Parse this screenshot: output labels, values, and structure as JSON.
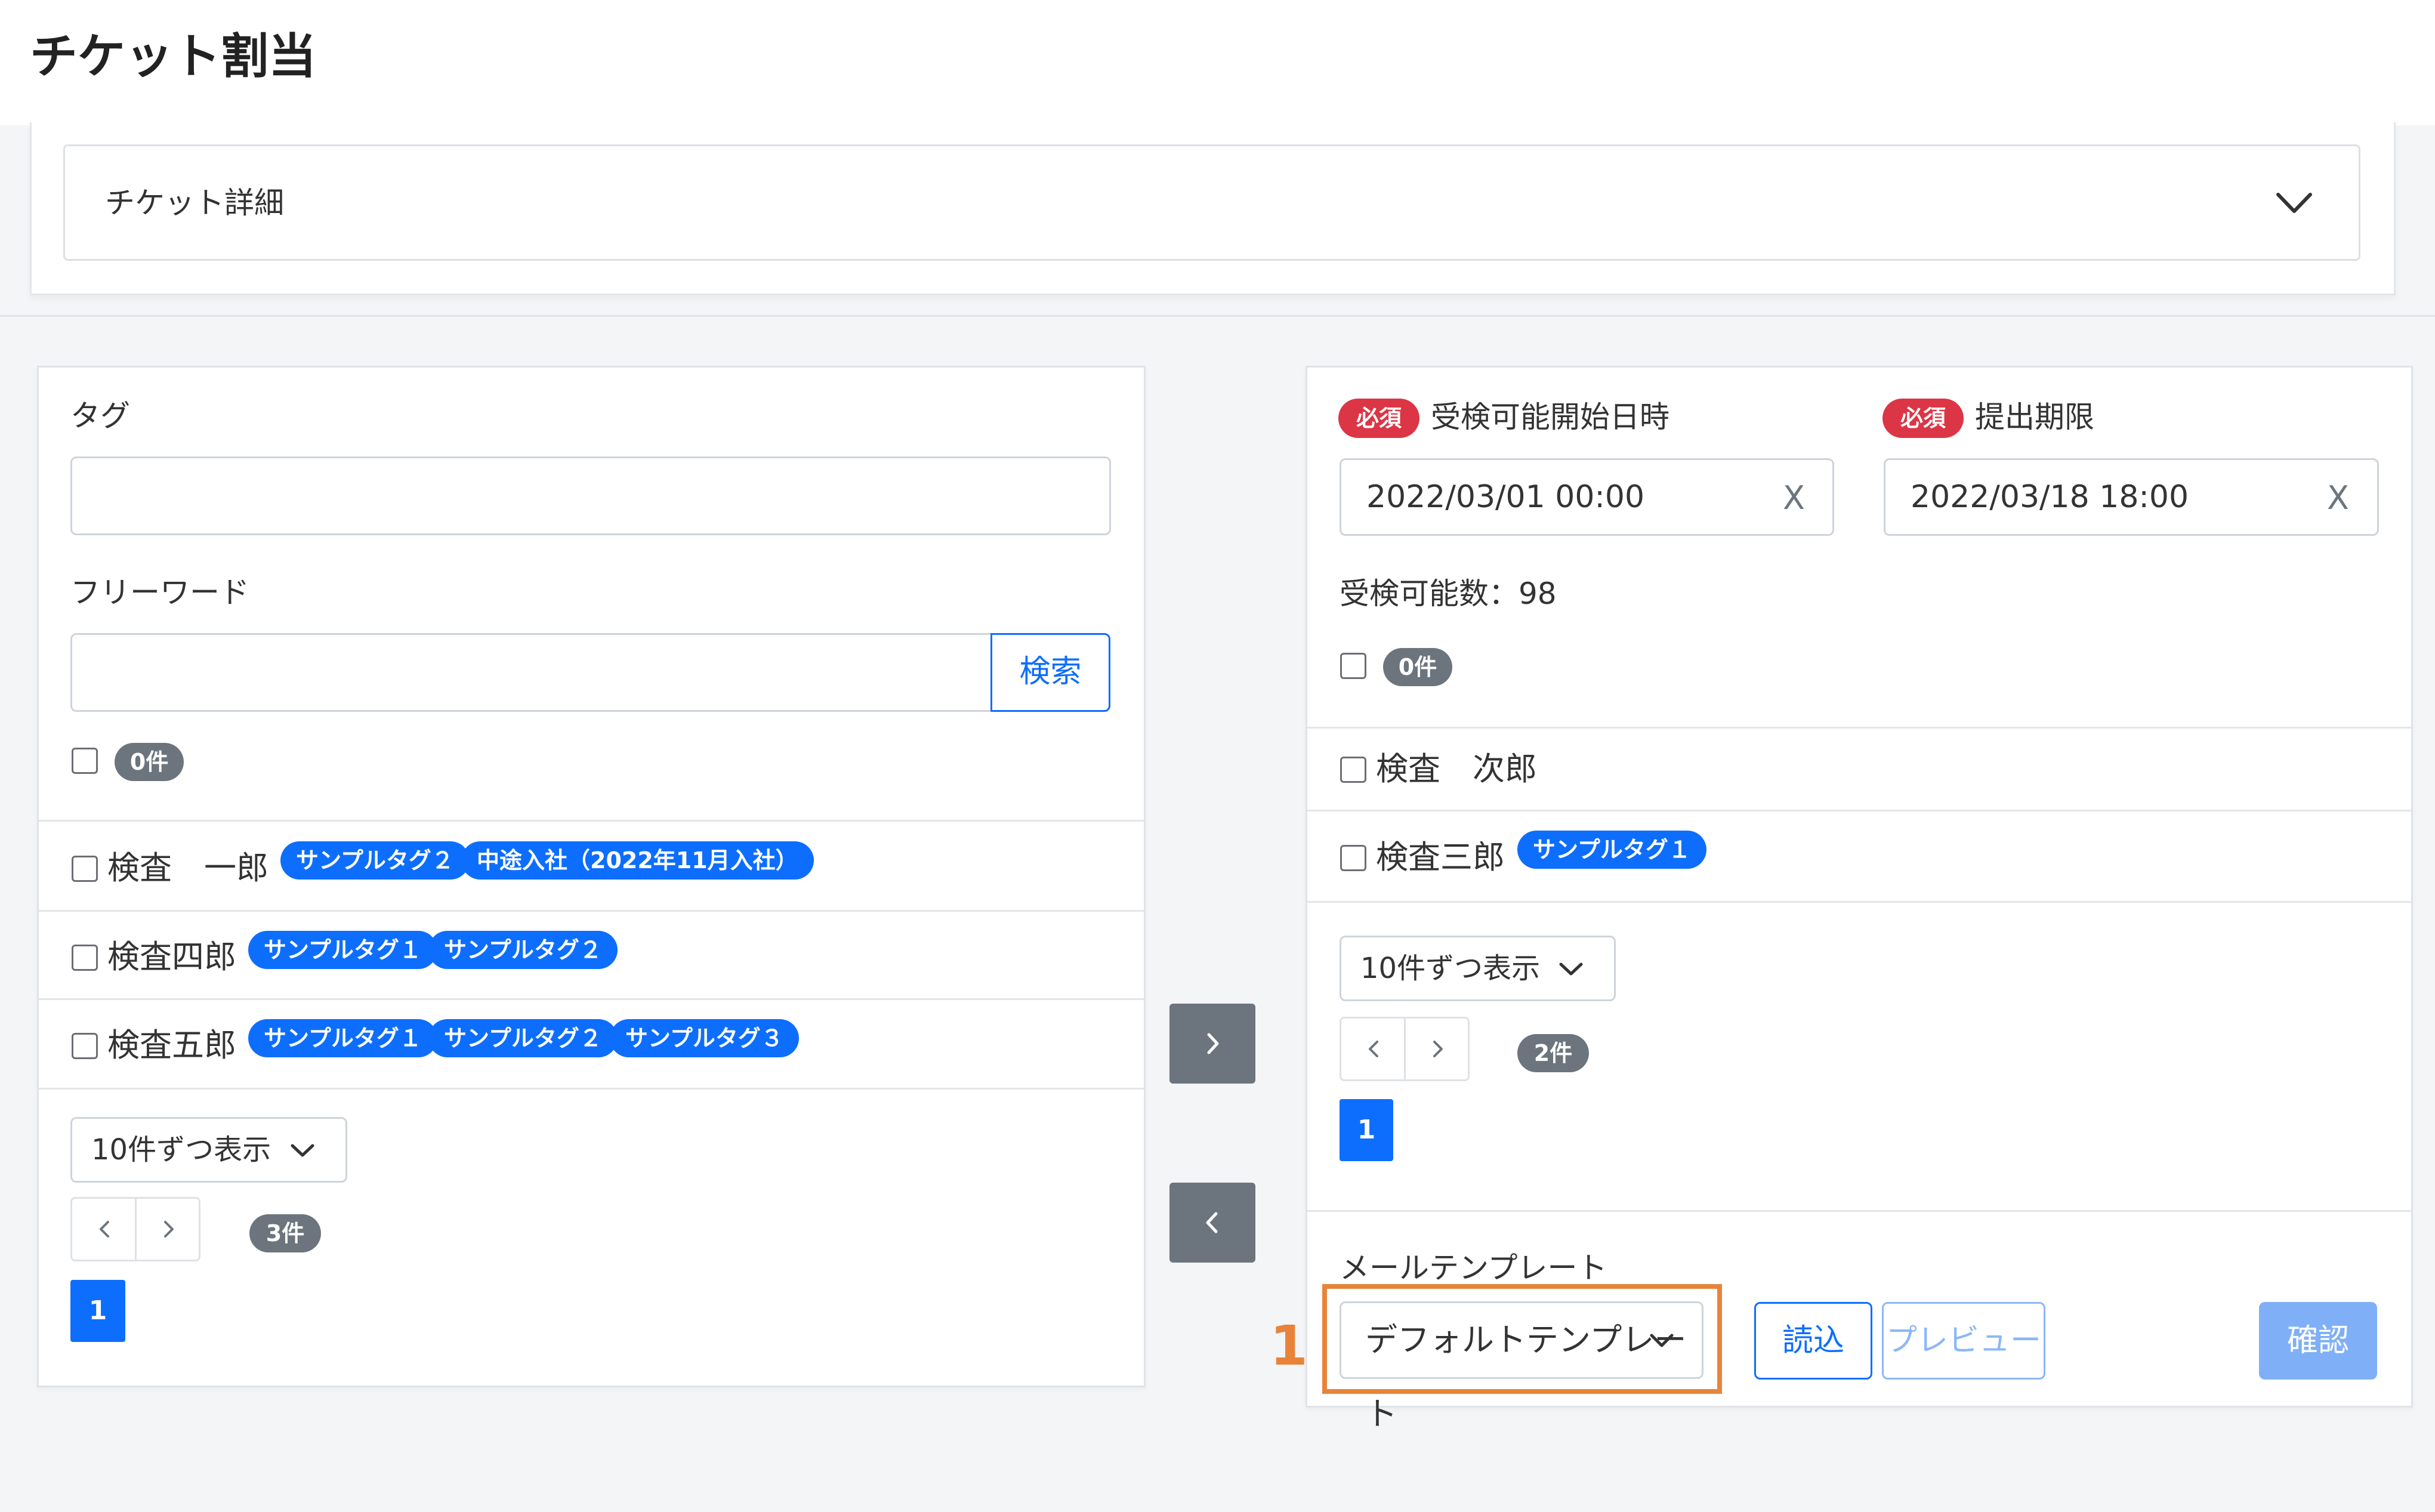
{
  "header": {
    "title": "チケット割当"
  },
  "detail": {
    "label": "チケット詳細",
    "icon": "chevron-down-icon"
  },
  "left": {
    "tag_label": "タグ",
    "tag_value": "",
    "freeword_label": "フリーワード",
    "freeword_value": "",
    "search_label": "検索",
    "selected_count": "0件",
    "rows": [
      {
        "name": "検査　一郎",
        "tags": [
          "サンプルタグ２",
          "中途入社（2022年11月入社）"
        ]
      },
      {
        "name": "検査四郎",
        "tags": [
          "サンプルタグ１",
          "サンプルタグ２"
        ]
      },
      {
        "name": "検査五郎",
        "tags": [
          "サンプルタグ１",
          "サンプルタグ２",
          "サンプルタグ３"
        ]
      }
    ],
    "page_size": "10件ずつ表示",
    "total": "3件",
    "current_page": "1"
  },
  "transfer": {
    "to_right_icon": "chevron-right-icon",
    "to_left_icon": "chevron-left-icon"
  },
  "right": {
    "required": "必須",
    "start_label": "受検可能開始日時",
    "start_value": "2022/03/01 00:00",
    "deadline_label": "提出期限",
    "deadline_value": "2022/03/18 18:00",
    "clear_glyph": "X",
    "available_text": "受検可能数：98",
    "selected_count": "0件",
    "rows": [
      {
        "name": "検査　次郎",
        "tags": []
      },
      {
        "name": "検査三郎",
        "tags": [
          "サンプルタグ１"
        ]
      }
    ],
    "page_size": "10件ずつ表示",
    "total": "2件",
    "current_page": "1",
    "mail_label": "メールテンプレート",
    "mail_value": "デフォルトテンプレート",
    "load_label": "読込",
    "preview_label": "プレビュー",
    "confirm_label": "確認"
  },
  "annotation": {
    "number": "1",
    "color": "#e8843a"
  },
  "colors": {
    "primary": "#0d6efd",
    "danger": "#dc3545",
    "secondary": "#6c757d"
  }
}
